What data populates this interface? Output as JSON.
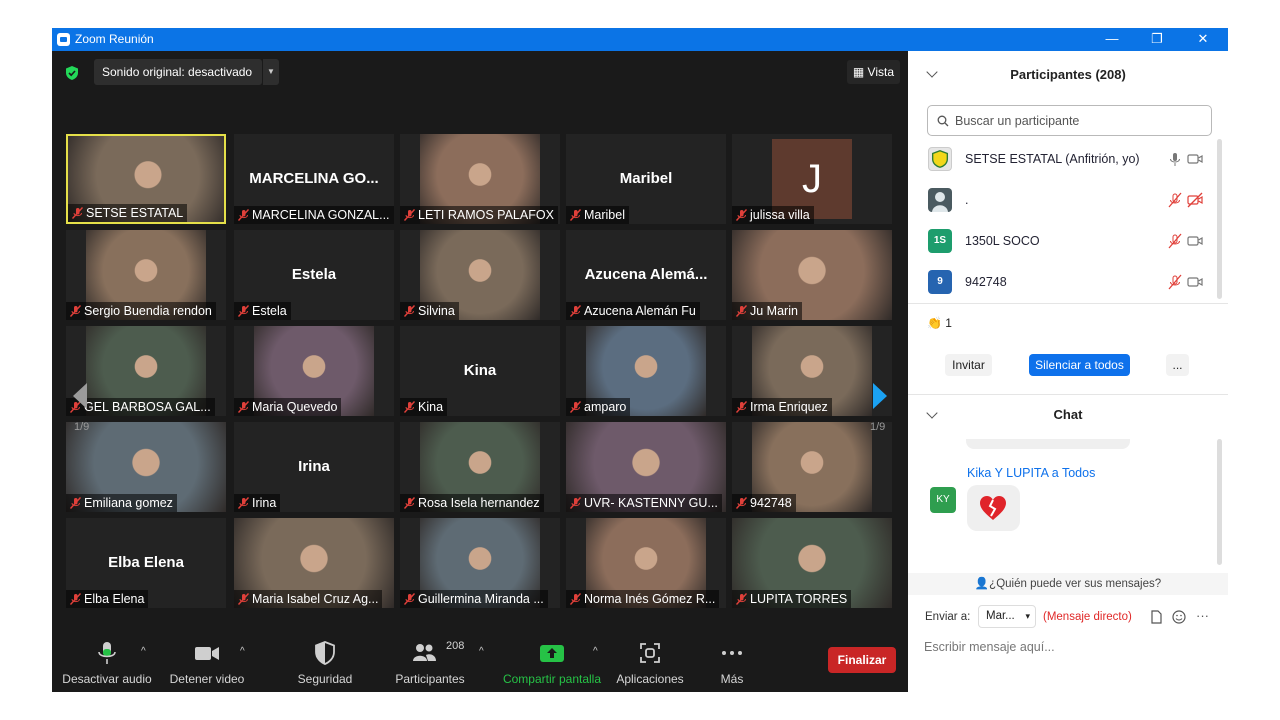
{
  "window": {
    "title": "Zoom Reunión",
    "controls": {
      "minimize": "—",
      "restore": "❐",
      "close": "✕"
    }
  },
  "top": {
    "sound": "Sonido original: desactivado",
    "vista": "Vista"
  },
  "grid": {
    "page_left": "1/9",
    "page_right": "1/9",
    "tiles": [
      {
        "name": "SETSE ESTATAL",
        "big": "",
        "letter": "",
        "active": true
      },
      {
        "name": "MARCELINA GONZAL...",
        "big": "MARCELINA  GO...",
        "letter": ""
      },
      {
        "name": "LETI RAMOS PALAFOX",
        "big": "",
        "letter": ""
      },
      {
        "name": "Maribel",
        "big": "Maribel",
        "letter": ""
      },
      {
        "name": "julissa villa",
        "big": "",
        "letter": "J"
      },
      {
        "name": "Sergio Buendia rendon",
        "big": "",
        "letter": ""
      },
      {
        "name": "Estela",
        "big": "Estela",
        "letter": ""
      },
      {
        "name": "Silvina",
        "big": "",
        "letter": ""
      },
      {
        "name": "Azucena Alemán Fu",
        "big": "Azucena  Alemá...",
        "letter": ""
      },
      {
        "name": "Ju Marin",
        "big": "",
        "letter": ""
      },
      {
        "name": "GEL BARBOSA GAL...",
        "big": "",
        "letter": ""
      },
      {
        "name": "Maria Quevedo",
        "big": "",
        "letter": ""
      },
      {
        "name": "Kina",
        "big": "Kina",
        "letter": ""
      },
      {
        "name": "amparo",
        "big": "",
        "letter": ""
      },
      {
        "name": "Irma Enriquez",
        "big": "",
        "letter": ""
      },
      {
        "name": "Emiliana gomez",
        "big": "",
        "letter": ""
      },
      {
        "name": "Irina",
        "big": "Irina",
        "letter": ""
      },
      {
        "name": "Rosa Isela hernandez",
        "big": "",
        "letter": ""
      },
      {
        "name": "UVR- KASTENNY GU...",
        "big": "",
        "letter": ""
      },
      {
        "name": "942748",
        "big": "",
        "letter": ""
      },
      {
        "name": "Elba Elena",
        "big": "Elba Elena",
        "letter": ""
      },
      {
        "name": "Maria Isabel Cruz Ag...",
        "big": "",
        "letter": ""
      },
      {
        "name": "Guillermina Miranda ...",
        "big": "",
        "letter": ""
      },
      {
        "name": "Norma Inés Gómez R...",
        "big": "",
        "letter": ""
      },
      {
        "name": "LUPITA TORRES",
        "big": "",
        "letter": ""
      }
    ]
  },
  "toolbar": {
    "audio": "Desactivar audio",
    "video": "Detener video",
    "security": "Seguridad",
    "participants": "Participantes",
    "participants_count": "208",
    "share": "Compartir pantalla",
    "apps": "Aplicaciones",
    "more": "Más",
    "end": "Finalizar"
  },
  "participants": {
    "title": "Participantes (208)",
    "search_placeholder": "Buscar un participante",
    "list": [
      {
        "name": "SETSE ESTATAL (Anfitrión, yo)",
        "initials": "",
        "color": "#e6e6e6"
      },
      {
        "name": ".",
        "initials": "",
        "color": "#4a4a4a"
      },
      {
        "name": "1350L SOCO",
        "initials": "1S",
        "color": "#1d9d6d"
      },
      {
        "name": "942748",
        "initials": "9",
        "color": "#2664b0"
      }
    ],
    "reactions": "1",
    "invite": "Invitar",
    "mute_all": "Silenciar a todos",
    "more": "..."
  },
  "chat": {
    "title": "Chat",
    "sender": "Kika Y LUPITA a Todos",
    "sender_initials": "KY",
    "who_can_see": "¿Quién puede ver sus mensajes?",
    "send_to_label": "Enviar a:",
    "send_to_value": "Mar...",
    "direct_label": "(Mensaje directo)",
    "input_placeholder": "Escribir mensaje aquí..."
  },
  "colors": {
    "accent": "#0e71eb",
    "end": "#c92626",
    "share": "#26c246",
    "titlebar": "#0b74e6"
  }
}
